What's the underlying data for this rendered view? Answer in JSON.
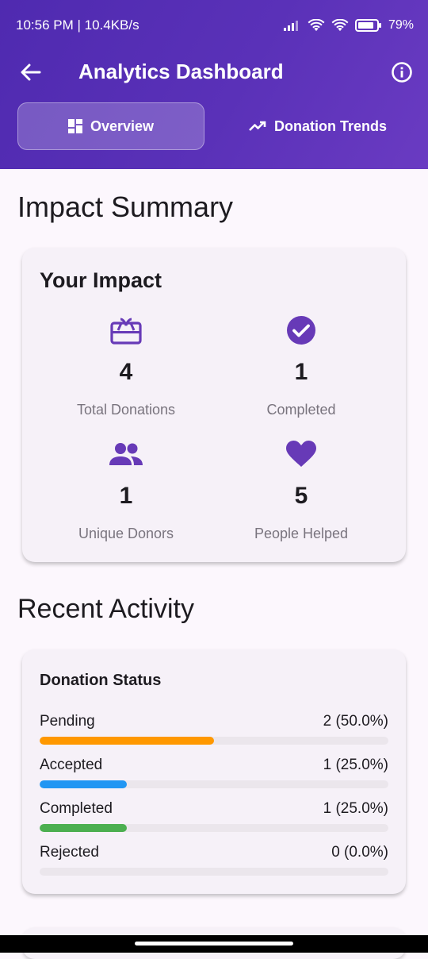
{
  "status_bar": {
    "time_speed": "10:56 PM | 10.4KB/s",
    "battery": "79%"
  },
  "app_bar": {
    "title": "Analytics Dashboard"
  },
  "tabs": [
    {
      "label": "Overview",
      "icon": "dashboard-icon",
      "selected": true
    },
    {
      "label": "Donation Trends",
      "icon": "trending-up-icon",
      "selected": false
    }
  ],
  "impact_summary": {
    "heading": "Impact Summary",
    "card_title": "Your Impact",
    "stats": [
      {
        "value": "4",
        "label": "Total Donations",
        "icon": "redeem-icon"
      },
      {
        "value": "1",
        "label": "Completed",
        "icon": "check-circle-icon"
      },
      {
        "value": "1",
        "label": "Unique Donors",
        "icon": "people-icon"
      },
      {
        "value": "5",
        "label": "People Helped",
        "icon": "heart-icon"
      }
    ]
  },
  "recent_activity": {
    "heading": "Recent Activity",
    "card_title": "Donation Status",
    "rows": [
      {
        "label": "Pending",
        "value": "2 (50.0%)",
        "fraction": 0.5,
        "color": "#ff9800"
      },
      {
        "label": "Accepted",
        "value": "1 (25.0%)",
        "fraction": 0.25,
        "color": "#2196f3"
      },
      {
        "label": "Completed",
        "value": "1 (25.0%)",
        "fraction": 0.25,
        "color": "#4caf50"
      },
      {
        "label": "Rejected",
        "value": "0 (0.0%)",
        "fraction": 0.0,
        "color": "#9e9e9e"
      }
    ]
  },
  "colors": {
    "primary": "#5a31b8",
    "icon_accent": "#673ab7",
    "background": "#fcf7fd"
  }
}
